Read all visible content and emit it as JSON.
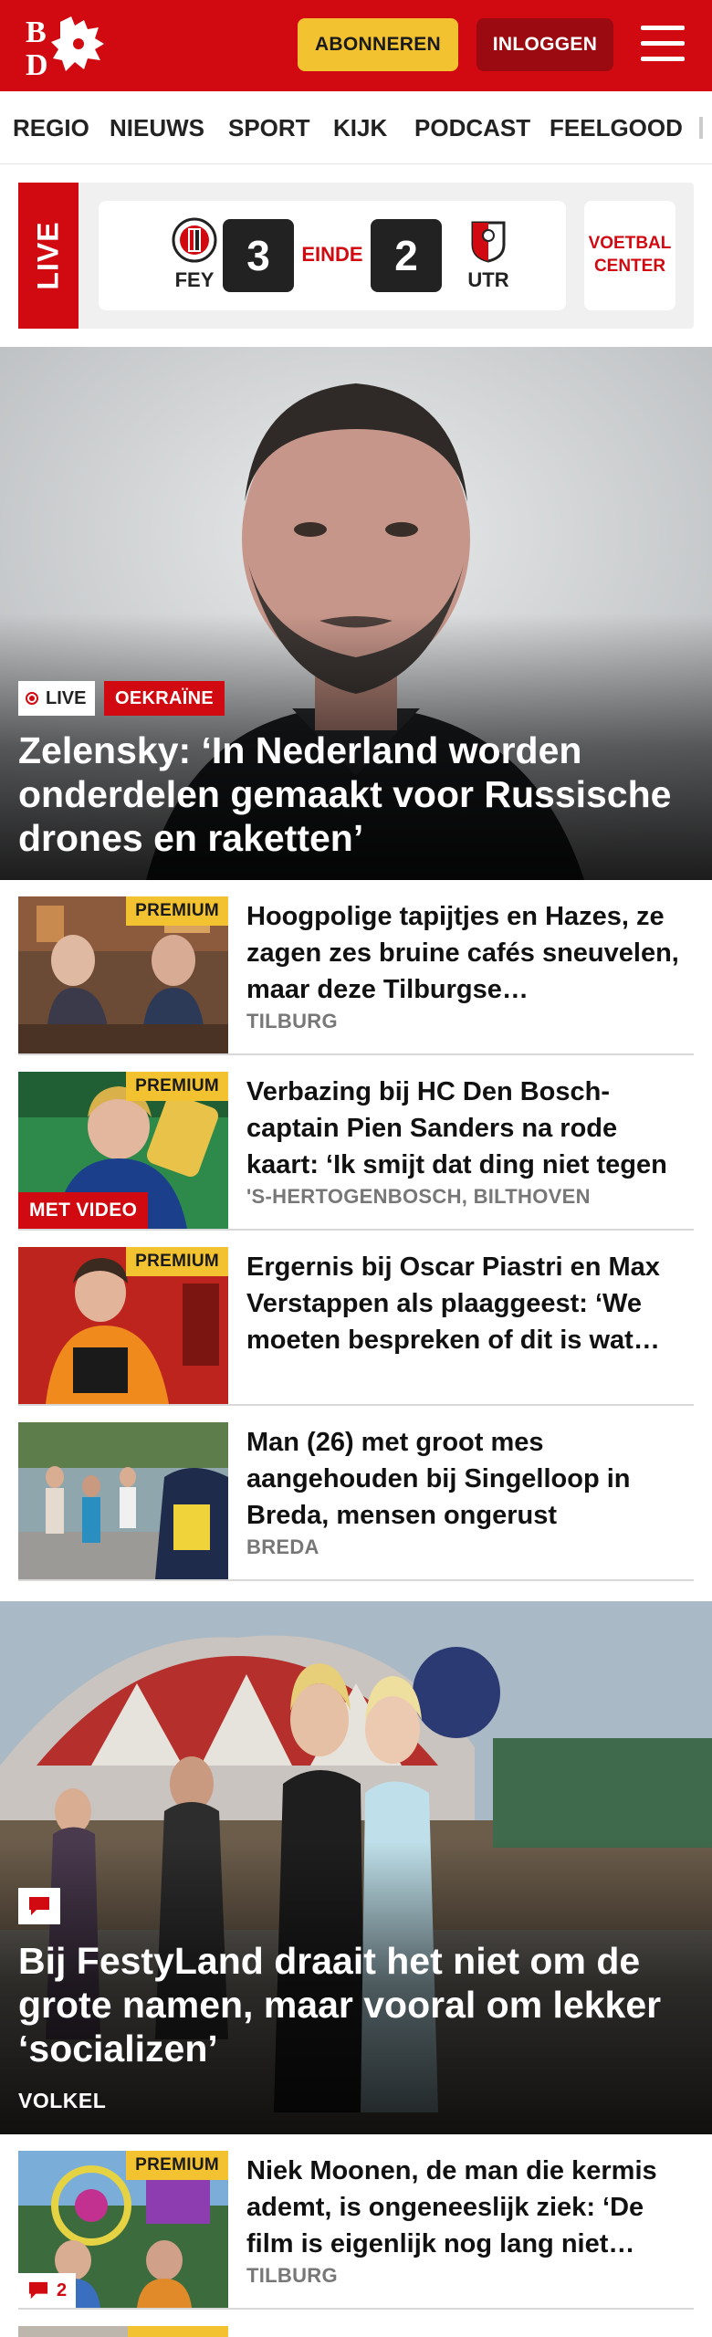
{
  "header": {
    "logo_alt": "BD",
    "subscribe_label": "ABONNEREN",
    "login_label": "INLOGGEN",
    "brand_color": "#d10a11",
    "accent_color": "#f2c230"
  },
  "nav": {
    "items": [
      "REGIO",
      "NIEUWS",
      "SPORT",
      "KIJK",
      "PODCAST",
      "FEELGOOD"
    ]
  },
  "live": {
    "tab_label": "LIVE",
    "home_team": "FEY",
    "home_score": "3",
    "status": "EINDE",
    "away_score": "2",
    "away_team": "UTR",
    "center_label_1": "VOETBAL",
    "center_label_2": "CENTER"
  },
  "hero": {
    "live_label": "LIVE",
    "topic": "OEKRAÏNE",
    "title": "Zelensky: ‘In Nederland worden onderdelen gemaakt voor Russische drones en raketten’"
  },
  "articles": [
    {
      "premium": "PREMIUM",
      "title": "Hoogpolige tapijtjes en Hazes, ze zagen zes bruine cafés sneuvelen, maar deze Tilburgse…",
      "location": "TILBURG"
    },
    {
      "premium": "PREMIUM",
      "video": "MET VIDEO",
      "title": "Verbazing bij HC Den Bosch-captain Pien Sanders na rode kaart: ‘Ik smijt dat ding niet tegen zijn…",
      "location": "'S-HERTOGENBOSCH, BILTHOVEN"
    },
    {
      "premium": "PREMIUM",
      "title": "Ergernis bij Oscar Piastri en Max Verstappen als plaaggeest: ‘We moeten bespreken of dit is wat…",
      "location": ""
    },
    {
      "title": "Man (26) met groot mes aangehouden bij Singelloop in Breda, mensen ongerust",
      "location": "BREDA"
    }
  ],
  "feature": {
    "title": "Bij FestyLand draait het niet om de grote namen, maar vooral om lekker ‘socializen’",
    "location": "VOLKEL"
  },
  "article_after": {
    "premium": "PREMIUM",
    "comment_count": "2",
    "title": "Niek Moonen, de man die kermis ademt, is ongeneeslijk ziek: ‘De film is eigenlijk nog lang niet…",
    "location": "TILBURG"
  }
}
